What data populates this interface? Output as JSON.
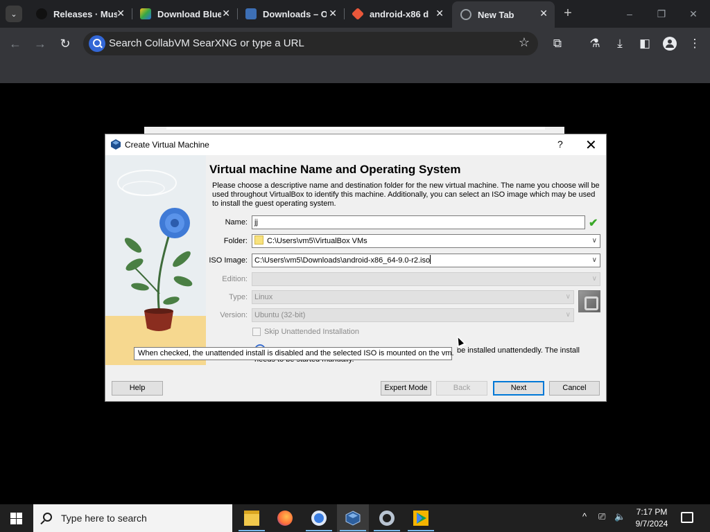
{
  "browser": {
    "tabs": [
      {
        "title": "Releases · Mus",
        "icon": "github-icon"
      },
      {
        "title": "Download Blue",
        "icon": "bluestacks-icon"
      },
      {
        "title": "Downloads – O",
        "icon": "osdn-icon"
      },
      {
        "title": "android-x86 d",
        "icon": "git-icon"
      },
      {
        "title": "New Tab",
        "icon": "globe-icon",
        "active": true
      }
    ],
    "omnibox_placeholder": "Search CollabVM SearXNG or type a URL"
  },
  "dialog": {
    "window_title": "Create Virtual Machine",
    "help_glyph": "?",
    "heading": "Virtual machine Name and Operating System",
    "description": "Please choose a descriptive name and destination folder for the new virtual machine. The name you choose will be used throughout VirtualBox to identify this machine. Additionally, you can select an ISO image which may be used to install the guest operating system.",
    "fields": {
      "name_label": "Name:",
      "name_value": "jj",
      "folder_label": "Folder:",
      "folder_value": "C:\\Users\\vm5\\VirtualBox VMs",
      "iso_label": "ISO Image:",
      "iso_value": "C:\\Users\\vm5\\Downloads\\android-x86_64-9.0-r2.iso",
      "edition_label": "Edition:",
      "edition_value": "",
      "type_label": "Type:",
      "type_value": "Linux",
      "version_label": "Version:",
      "version_value": "Ubuntu (32-bit)"
    },
    "skip_unattended_label": "Skip Unattended Installation",
    "skip_unattended_checked": false,
    "info_text": "be installed unattendedly. The install needs to be started manually.",
    "tooltip": "When checked, the unattended install is disabled and the selected ISO is mounted on the vm.",
    "buttons": {
      "help": "Help",
      "expert": "Expert Mode",
      "back": "Back",
      "next": "Next",
      "cancel": "Cancel"
    }
  },
  "taskbar": {
    "search_placeholder": "Type here to search",
    "apps": [
      "file-explorer-icon",
      "firefox-icon",
      "chrome-icon",
      "virtualbox-icon",
      "settings-icon",
      "play-store-icon"
    ],
    "time": "7:17 PM",
    "date": "9/7/2024"
  },
  "colors": {
    "accent": "#0078d7",
    "browser_dark": "#202124",
    "toolbar": "#35363a",
    "ok_check": "#3aa828"
  }
}
